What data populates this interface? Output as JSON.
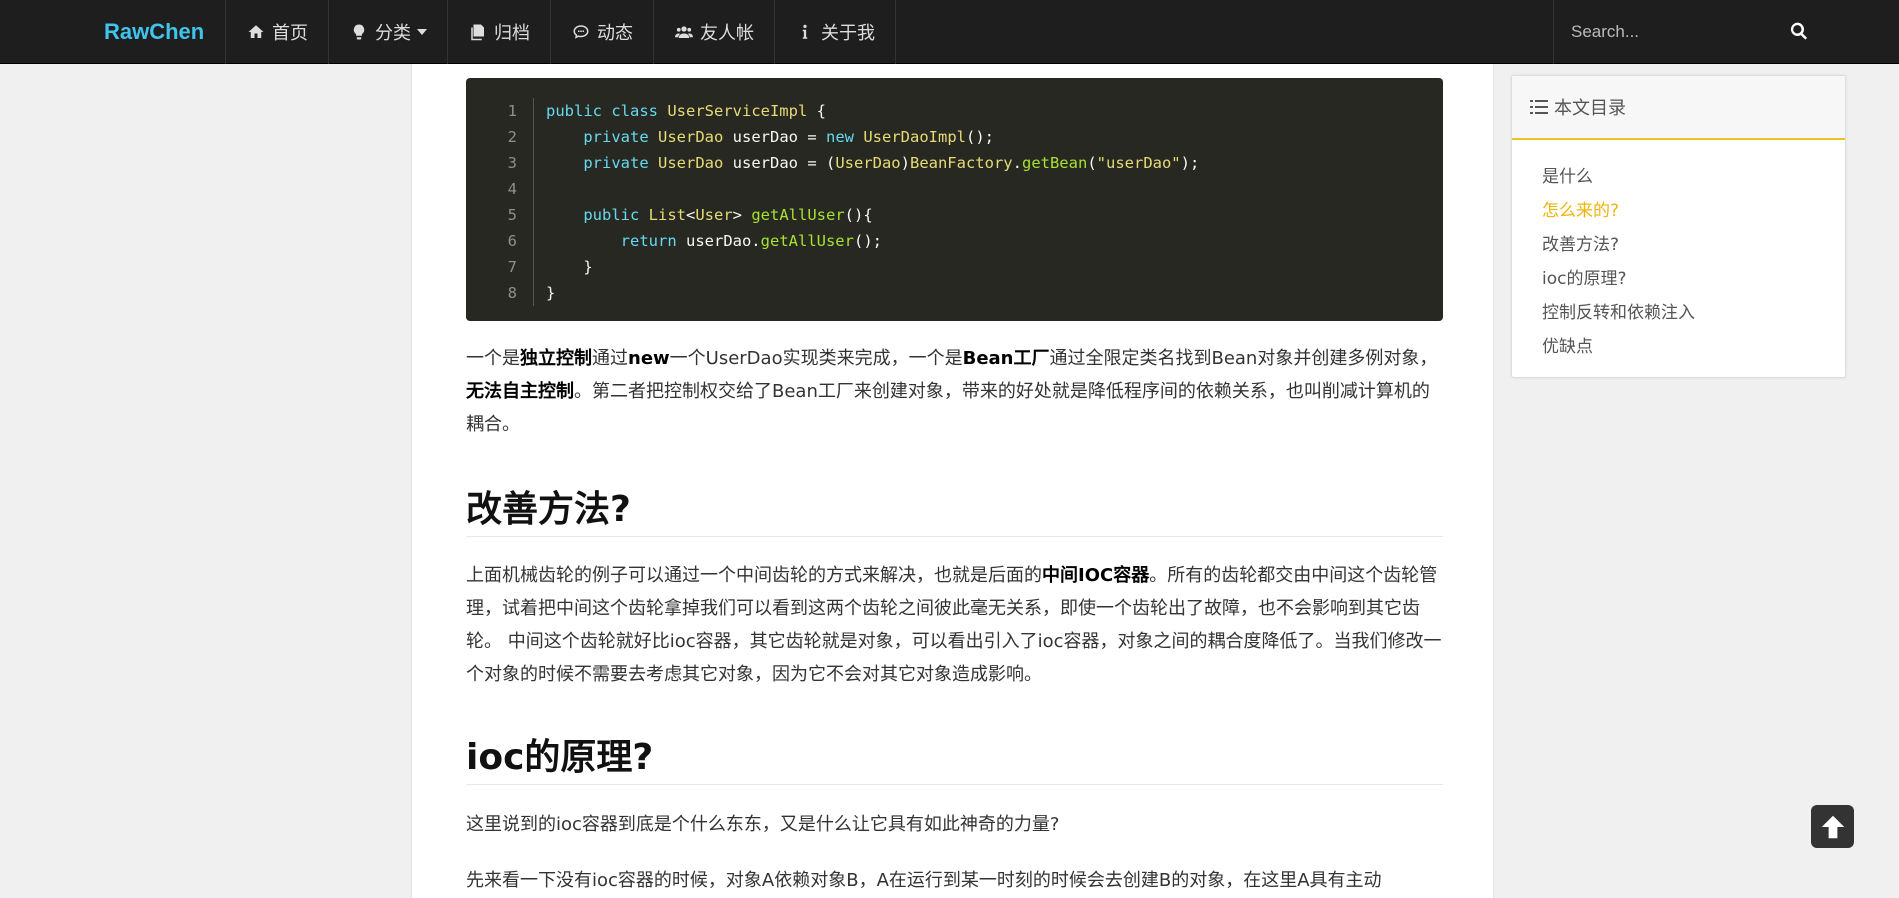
{
  "nav": {
    "brand": "RawChen",
    "items": [
      {
        "label": "首页",
        "icon": "home-icon"
      },
      {
        "label": "分类",
        "icon": "lightbulb-icon"
      },
      {
        "label": "归档",
        "icon": "archive-icon"
      },
      {
        "label": "动态",
        "icon": "comment-icon"
      },
      {
        "label": "友人帐",
        "icon": "users-icon"
      },
      {
        "label": "关于我",
        "icon": "info-icon"
      }
    ],
    "search_placeholder": "Search..."
  },
  "code": {
    "line_numbers": [
      "1",
      "2",
      "3",
      "4",
      "5",
      "6",
      "7",
      "8"
    ]
  },
  "article": {
    "p1": {
      "t1": "一个是",
      "b1": "独立控制",
      "t2": "通过",
      "b2": "new",
      "t3": "一个UserDao实现类来完成，一个是",
      "b3": "Bean工厂",
      "t4": "通过全限定类名找到Bean对象并创建多例对象，",
      "b4": "无法自主控制",
      "t5": "。第二者把控制权交给了Bean工厂来创建对象，带来的好处就是降低程序间的依赖关系，也叫削减计算机的耦合。"
    },
    "h2_improve": "改善方法?",
    "p2": {
      "t1": "上面机械齿轮的例子可以通过一个中间齿轮的方式来解决，也就是后面的",
      "b1": "中间IOC容器",
      "t2": "。所有的齿轮都交由中间这个齿轮管理，试着把中间这个齿轮拿掉我们可以看到这两个齿轮之间彼此毫无关系，即使一个齿轮出了故障，也不会影响到其它齿轮。 中间这个齿轮就好比ioc容器，其它齿轮就是对象，可以看出引入了ioc容器，对象之间的耦合度降低了。当我们修改一个对象的时候不需要去考虑其它对象，因为它不会对其它对象造成影响。"
    },
    "h2_ioc": "ioc的原理?",
    "p3": "这里说到的ioc容器到底是个什么东东，又是什么让它具有如此神奇的力量?",
    "p4": "先来看一下没有ioc容器的时候，对象A依赖对象B，A在运行到某一时刻的时候会去创建B的对象，在这里A具有主动"
  },
  "toc": {
    "title": "本文目录",
    "items": [
      "是什么",
      "怎么来的?",
      "改善方法?",
      "ioc的原理?",
      "控制反转和依赖注入",
      "优缺点"
    ],
    "active_index": 1,
    "active_color": "#f0b40a"
  },
  "colors": {
    "brand": "#3fc4ec",
    "navbar_bg": "#1e1e1e",
    "code_bg": "#272822"
  }
}
